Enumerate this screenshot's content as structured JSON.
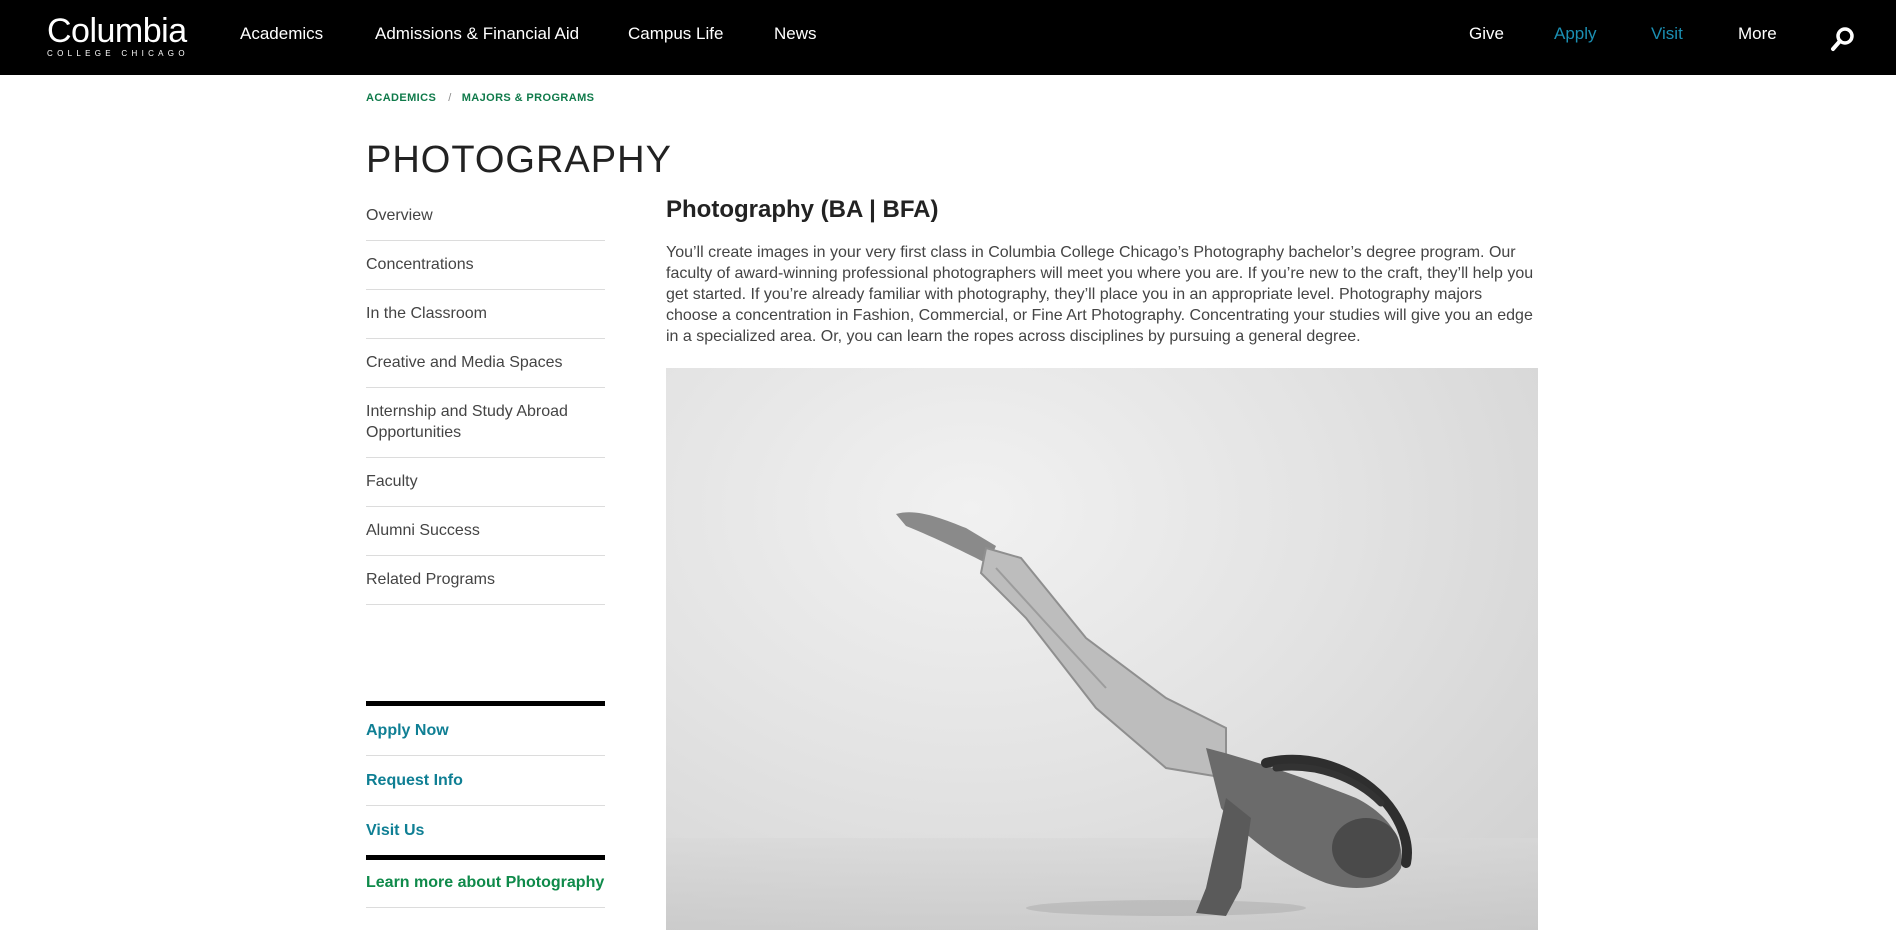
{
  "header": {
    "logo_main": "Columbia",
    "logo_sub": "COLLEGE CHICAGO",
    "nav": [
      {
        "label": "Academics"
      },
      {
        "label": "Admissions & Financial Aid"
      },
      {
        "label": "Campus Life"
      },
      {
        "label": "News"
      }
    ],
    "utility": [
      {
        "label": "Give"
      },
      {
        "label": "Apply"
      },
      {
        "label": "Visit"
      },
      {
        "label": "More"
      }
    ],
    "search_icon": "search-icon"
  },
  "breadcrumb": {
    "items": [
      "ACADEMICS",
      "MAJORS & PROGRAMS"
    ],
    "separator": "/"
  },
  "page_title": "PHOTOGRAPHY",
  "sidenav": [
    "Overview",
    "Concentrations",
    "In the Classroom",
    "Creative and Media Spaces",
    "Internship and Study Abroad Opportunities",
    "Faculty",
    "Alumni Success",
    "Related Programs"
  ],
  "cta": {
    "apply": "Apply Now",
    "request": "Request Info",
    "visit": "Visit Us",
    "learn": "Learn more about Photography"
  },
  "main": {
    "heading": "Photography (BA | BFA)",
    "intro": "You’ll create images in your very first class in Columbia College Chicago’s Photography bachelor’s degree program. Our faculty of award-winning professional photographers will meet you where you are. If you’re new to the craft, they’ll help you get started. If you’re already familiar with photography, they’ll place you in an appropriate level. Photography majors choose a concentration in Fashion, Commercial, or Fine Art Photography. Concentrating your studies will give you an edge in a specialized area. Or, you can learn the ropes across disciplines by pursuing a general degree."
  },
  "colors": {
    "header_bg": "#000000",
    "accent_blue": "#1b8fb3",
    "breadcrumb_green": "#0f7a4a",
    "cta_teal": "#0f7f94",
    "learn_green": "#0f8a4a"
  }
}
